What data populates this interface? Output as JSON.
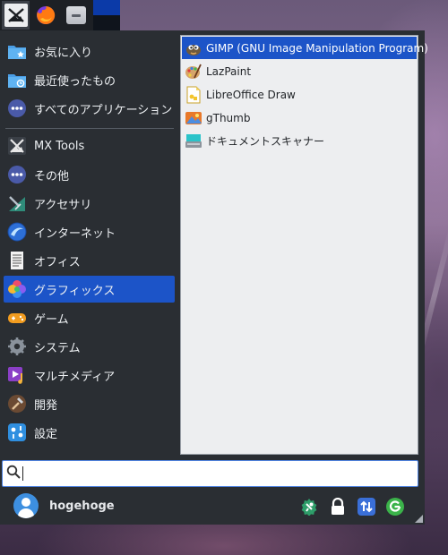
{
  "panel": {
    "launchers": [
      {
        "icon": "mx-logo-icon"
      },
      {
        "icon": "firefox-icon"
      },
      {
        "icon": "file-manager-icon"
      }
    ],
    "pager": {
      "workspaces": 2,
      "active": 1
    }
  },
  "menu": {
    "categories": [
      {
        "label": "お気に入り",
        "icon": "favorites-folder-icon"
      },
      {
        "label": "最近使ったもの",
        "icon": "recent-folder-icon"
      },
      {
        "label": "すべてのアプリケーション",
        "icon": "all-apps-icon"
      },
      {
        "label": "MX Tools",
        "icon": "mx-tools-icon"
      },
      {
        "label": "その他",
        "icon": "other-icon"
      },
      {
        "label": "アクセサリ",
        "icon": "accessories-icon"
      },
      {
        "label": "インターネット",
        "icon": "internet-icon"
      },
      {
        "label": "オフィス",
        "icon": "office-icon"
      },
      {
        "label": "グラフィックス",
        "icon": "graphics-icon"
      },
      {
        "label": "ゲーム",
        "icon": "games-icon"
      },
      {
        "label": "システム",
        "icon": "system-icon"
      },
      {
        "label": "マルチメディア",
        "icon": "multimedia-icon"
      },
      {
        "label": "開発",
        "icon": "development-icon"
      },
      {
        "label": "設定",
        "icon": "settings-icon"
      }
    ],
    "active_category": "グラフィックス",
    "apps": [
      {
        "label": "GIMP (GNU Image Manipulation Program)",
        "icon": "gimp-icon"
      },
      {
        "label": "LazPaint",
        "icon": "lazpaint-icon"
      },
      {
        "label": "LibreOffice Draw",
        "icon": "libreoffice-draw-icon"
      },
      {
        "label": "gThumb",
        "icon": "gthumb-icon"
      },
      {
        "label": "ドキュメントスキャナー",
        "icon": "document-scanner-icon"
      }
    ],
    "active_app": "GIMP (GNU Image Manipulation Program)"
  },
  "search": {
    "value": "",
    "placeholder": ""
  },
  "user": {
    "name": "hogehoge"
  },
  "actions": [
    {
      "name": "settings-manager",
      "icon": "settings-manager-icon",
      "color": "#2e9e6a"
    },
    {
      "name": "lock-screen",
      "icon": "lock-icon",
      "color": "#ffffff"
    },
    {
      "name": "switch-user",
      "icon": "switch-user-icon",
      "color": "#3a6fd8"
    },
    {
      "name": "log-out",
      "icon": "log-out-icon",
      "color": "#3bb34a"
    }
  ],
  "colors": {
    "accent": "#1c54c8",
    "menu_bg": "#2a2e33",
    "submenu_bg": "#edeef0"
  }
}
